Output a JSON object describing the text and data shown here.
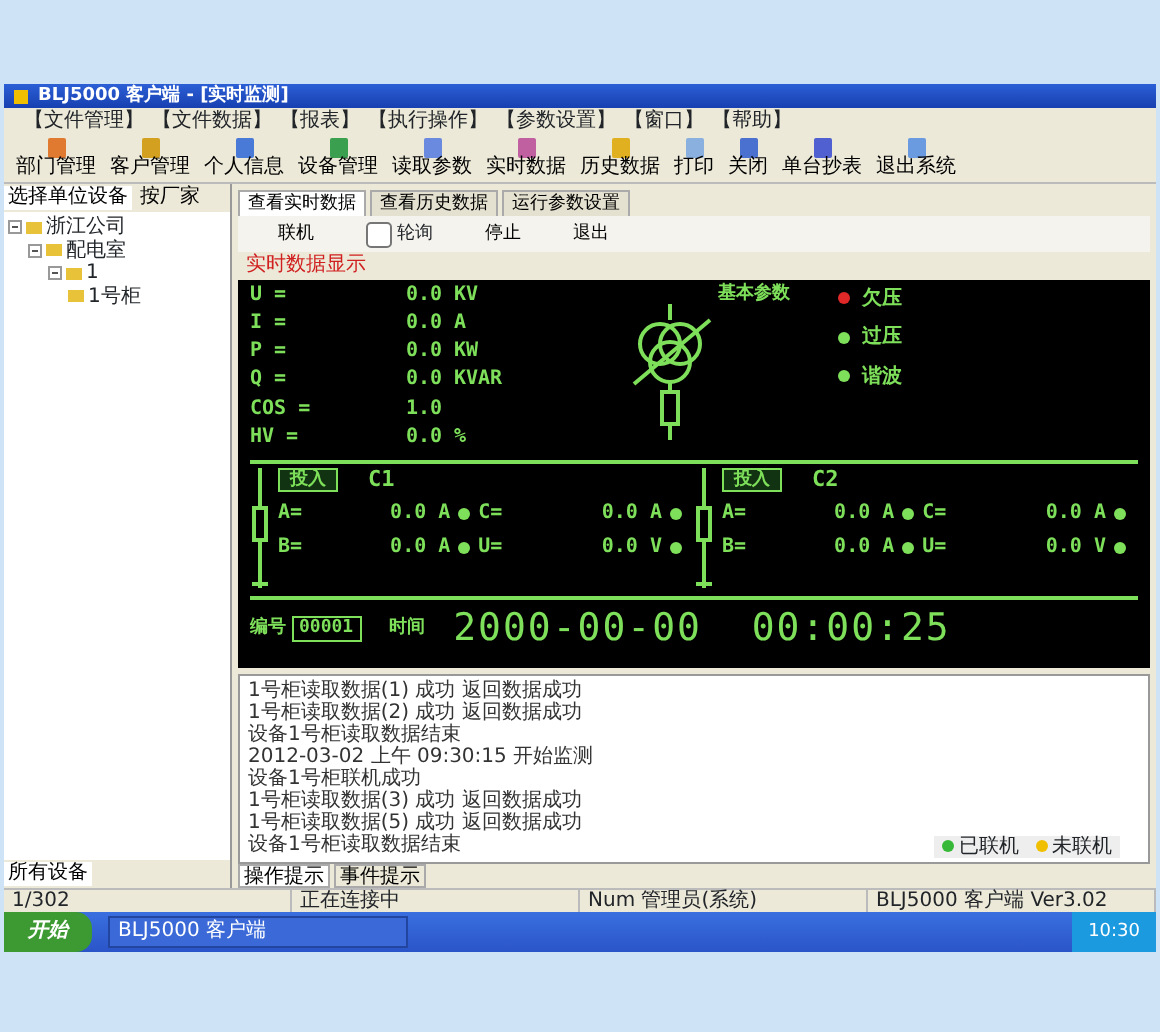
{
  "window": {
    "title": "BLJ5000 客户端 - [实时监测]"
  },
  "menu": [
    "【文件管理】",
    "【文件数据】",
    "【报表】",
    "【执行操作】",
    "【参数设置】",
    "【窗口】",
    "【帮助】"
  ],
  "toolbar": [
    "部门管理",
    "客户管理",
    "个人信息",
    "设备管理",
    "读取参数",
    "实时数据",
    "历史数据",
    "打印",
    "关闭",
    "单台抄表",
    "退出系统"
  ],
  "sidebar": {
    "tabs": [
      {
        "label": "选择单位设备",
        "selected": true
      },
      {
        "label": "按厂家",
        "selected": false
      }
    ],
    "tree": [
      {
        "label": "浙江公司",
        "expanded": true,
        "children": [
          {
            "label": "配电室",
            "expanded": true,
            "children": [
              {
                "label": "1",
                "expanded": true,
                "children": [
                  {
                    "label": "1号柜"
                  }
                ]
              }
            ]
          }
        ]
      }
    ],
    "bottom_tab": "所有设备"
  },
  "tabs": [
    {
      "label": "查看实时数据",
      "selected": true
    },
    {
      "label": "查看历史数据",
      "selected": false
    },
    {
      "label": "运行参数设置",
      "selected": false
    }
  ],
  "controls": [
    {
      "kind": "button",
      "label": "联机"
    },
    {
      "kind": "checkbox",
      "label": "轮询",
      "checked": false
    },
    {
      "kind": "button",
      "label": "停止"
    },
    {
      "kind": "button",
      "label": "退出"
    }
  ],
  "panel_title": "实时数据显示",
  "display": {
    "params": [
      {
        "label": "U =",
        "value": "0.0",
        "unit": "KV"
      },
      {
        "label": "I =",
        "value": "0.0",
        "unit": "A"
      },
      {
        "label": "P =",
        "value": "0.0",
        "unit": "KW"
      },
      {
        "label": "Q =",
        "value": "0.0",
        "unit": "KVAR"
      },
      {
        "label": "COS =",
        "value": "1.0"
      },
      {
        "label": "HV =",
        "value": "0.0",
        "unit": "%"
      }
    ],
    "diagram_label": "基本参数",
    "alarms": [
      {
        "label": "欠压",
        "color": "#e02828"
      },
      {
        "label": "过压",
        "color": "#7ee05a"
      },
      {
        "label": "谐波",
        "color": "#7ee05a"
      }
    ],
    "feeders": [
      {
        "button": "投入",
        "name": "C1",
        "rows": [
          {
            "label": "A=",
            "value": "0.0 A",
            "label2": "C=",
            "value2": "0.0 A"
          },
          {
            "label": "B=",
            "value": "0.0 A",
            "label2": "U=",
            "value2": "0.0 V"
          }
        ]
      },
      {
        "button": "投入",
        "name": "C2",
        "rows": [
          {
            "label": "A=",
            "value": "0.0 A",
            "label2": "C=",
            "value2": "0.0 A"
          },
          {
            "label": "B=",
            "value": "0.0 A",
            "label2": "U=",
            "value2": "0.0 V"
          }
        ]
      }
    ],
    "id_label": "编号",
    "id_value": "00001",
    "time_label": "时间",
    "time": "2000-00-00  00:00:25"
  },
  "log": {
    "lines": [
      "1号柜读取数据(1) 成功 返回数据成功",
      "1号柜读取数据(2) 成功 返回数据成功",
      "设备1号柜读取数据结束",
      "2012-03-02 上午 09:30:15 开始监测",
      "设备1号柜联机成功",
      "1号柜读取数据(3) 成功 返回数据成功",
      "1号柜读取数据(5) 成功 返回数据成功",
      "设备1号柜读取数据结束"
    ],
    "tabs": [
      {
        "label": "操作提示",
        "selected": true
      },
      {
        "label": "事件提示",
        "selected": false
      }
    ],
    "legend": [
      {
        "label": "已联机",
        "color": "#38b838"
      },
      {
        "label": "未联机",
        "color": "#f0c000"
      }
    ]
  },
  "status_bar": [
    "1/302",
    "正在连接中",
    "Num 管理员(系统)",
    "BLJ5000 客户端 Ver3.02"
  ],
  "taskbar": {
    "start": "开始",
    "window": "BLJ5000 客户端",
    "clock": "10:30"
  }
}
